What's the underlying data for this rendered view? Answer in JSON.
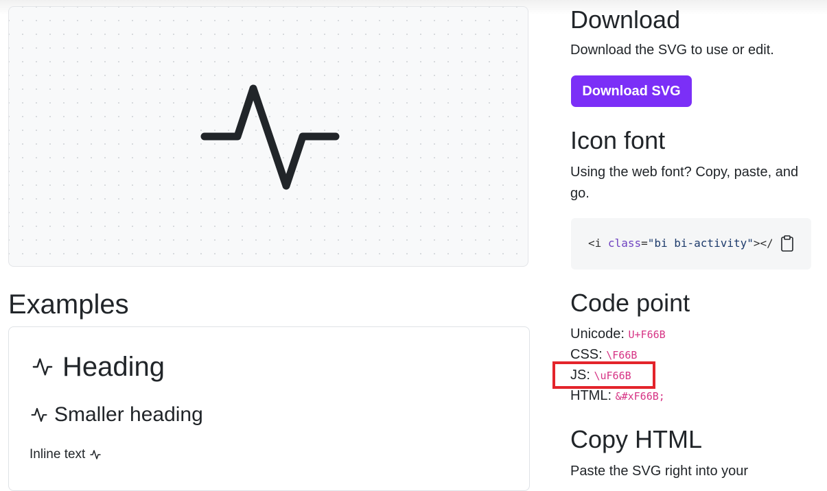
{
  "preview": {
    "icon": "activity-icon"
  },
  "examples": {
    "title": "Examples",
    "heading": "Heading",
    "smaller_heading": "Smaller heading",
    "inline_text": "Inline text"
  },
  "download": {
    "title": "Download",
    "description": "Download the SVG to use or edit.",
    "button_label": "Download SVG",
    "button_color": "#7b2ff7"
  },
  "icon_font": {
    "title": "Icon font",
    "description": "Using the web font? Copy, paste, and go.",
    "code_open": "<",
    "code_tag": "i",
    "code_attr": "class",
    "code_eq": "=",
    "code_value": "\"bi bi-activity\"",
    "code_close": "></",
    "copy_icon": "clipboard-icon"
  },
  "code_point": {
    "title": "Code point",
    "rows": [
      {
        "label": "Unicode:",
        "value": "U+F66B"
      },
      {
        "label": "CSS:",
        "value": "\\F66B"
      },
      {
        "label": "JS:",
        "value": "\\uF66B"
      },
      {
        "label": "HTML:",
        "value": "&#xF66B;"
      }
    ],
    "highlight_color": "#e3242b"
  },
  "copy_html": {
    "title": "Copy HTML",
    "description": "Paste the SVG right into your"
  }
}
